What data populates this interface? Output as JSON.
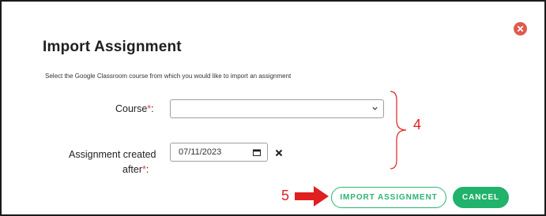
{
  "dialog": {
    "title": "Import Assignment",
    "subtitle": "Select the Google Classroom course from which you would like to import an assignment"
  },
  "form": {
    "course_label": "Course",
    "course_value": "",
    "date_label_line1": "Assignment created",
    "date_label_line2": "after",
    "required_mark": "*",
    "label_colon": ":",
    "date_value": "07/11/2023"
  },
  "annotations": {
    "bracket_number": "4",
    "arrow_number": "5"
  },
  "buttons": {
    "import_label": "IMPORT ASSIGNMENT",
    "cancel_label": "CANCEL"
  },
  "colors": {
    "accent_green": "#21b26b",
    "close_red": "#e05a4e",
    "required_red": "#e0433b",
    "annotation_red": "#e02020"
  },
  "icons": {
    "close": "close-circle-icon",
    "select_chevron": "chevron-down-icon",
    "calendar": "calendar-icon",
    "clear": "clear-x-icon",
    "arrow": "right-arrow-icon"
  }
}
